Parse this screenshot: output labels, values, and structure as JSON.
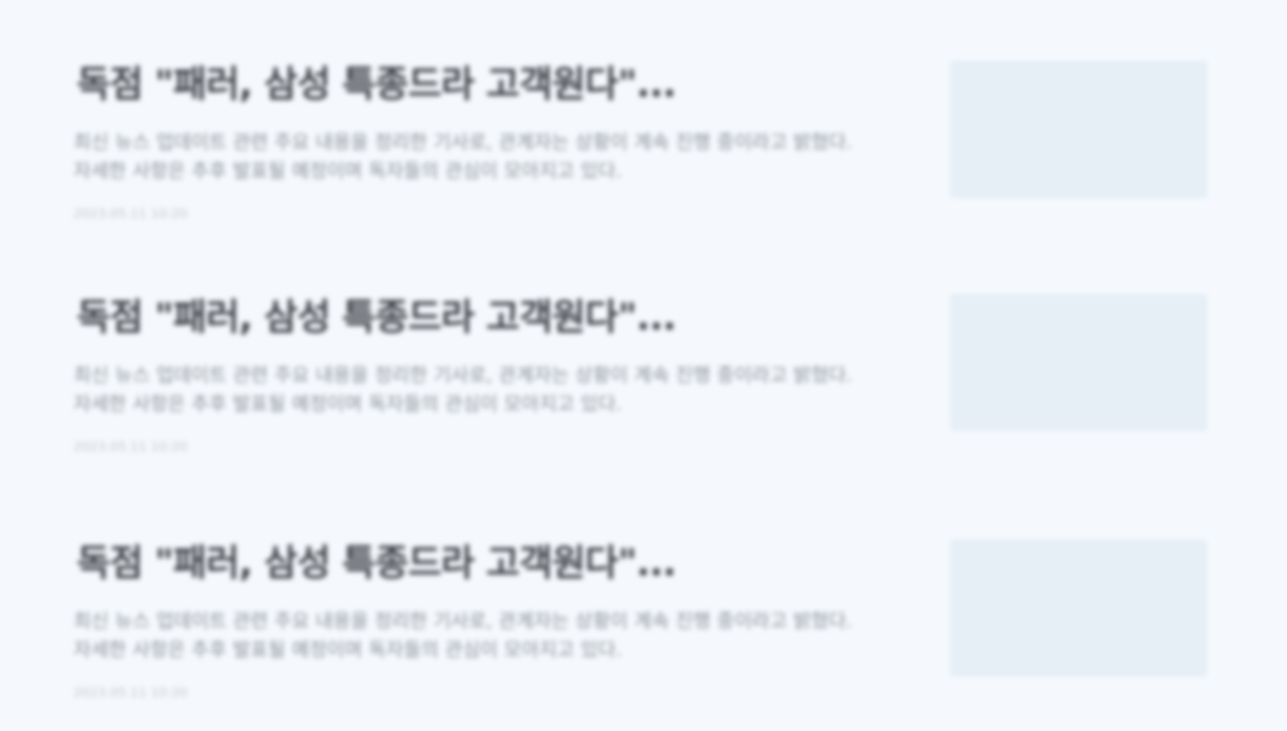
{
  "articles": [
    {
      "title": "독점 \"패러, 삼성 특종드라 고객원다\"...",
      "summary": "최신 뉴스 업데이트 관련 주요 내용을 정리한 기사로, 관계자는 상황이 계속 진행 중이라고 밝혔다. 자세한 사항은 추후 발표될 예정이며 독자들의 관심이 모아지고 있다.",
      "meta": "2023.05.11 10:20",
      "thumbnail_color": "#e6eef6"
    },
    {
      "title": "독점 \"패러, 삼성 특종드라 고객원다\"...",
      "summary": "최신 뉴스 업데이트 관련 주요 내용을 정리한 기사로, 관계자는 상황이 계속 진행 중이라고 밝혔다. 자세한 사항은 추후 발표될 예정이며 독자들의 관심이 모아지고 있다.",
      "meta": "2023.05.11 10:20",
      "thumbnail_color": "#e6eef6"
    },
    {
      "title": "독점 \"패러, 삼성 특종드라 고객원다\"...",
      "summary": "최신 뉴스 업데이트 관련 주요 내용을 정리한 기사로, 관계자는 상황이 계속 진행 중이라고 밝혔다. 자세한 사항은 추후 발표될 예정이며 독자들의 관심이 모아지고 있다.",
      "meta": "2023.05.11 10:20",
      "thumbnail_color": "#e6eef6"
    }
  ],
  "colors": {
    "background": "#f5f9fd",
    "title": "#3b3e44",
    "summary": "#8a8f97",
    "meta": "#c2c6cc"
  }
}
